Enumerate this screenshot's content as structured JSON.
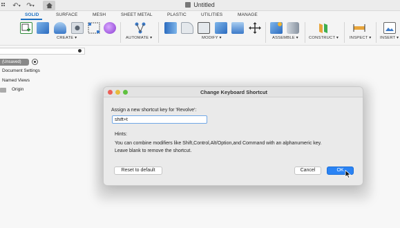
{
  "window": {
    "title": "Untitled"
  },
  "tabs": [
    "SOLID",
    "SURFACE",
    "MESH",
    "SHEET METAL",
    "PLASTIC",
    "UTILITIES",
    "MANAGE"
  ],
  "active_tab": "SOLID",
  "ribbon": {
    "groups": [
      "CREATE ▾",
      "AUTOMATE ▾",
      "MODIFY ▾",
      "ASSEMBLE ▾",
      "CONSTRUCT ▾",
      "INSPECT ▾",
      "INSERT ▾"
    ]
  },
  "browser": {
    "document_label": "(Unsaved)",
    "items": [
      "Document Settings",
      "Named Views",
      "Origin"
    ]
  },
  "dialog": {
    "title": "Change Keyboard Shortcut",
    "prompt": "Assign a new shortcut key for 'Revolve':",
    "shortcut_value": "shift+t",
    "hints_label": "Hints:",
    "hint_line_1": "You can combine modifiers like Shift,Control,Alt/Option,and Command with an alphanumeric key.",
    "hint_line_2": "Leave blank to remove the shortcut.",
    "reset_label": "Reset to default",
    "cancel_label": "Cancel",
    "ok_label": "OK"
  },
  "colors": {
    "accent": "#1a6fc2",
    "ok_button": "#2a83f4",
    "traffic_close": "#ec5f57",
    "traffic_min": "#e6bb3d",
    "traffic_max": "#5fc13f"
  }
}
